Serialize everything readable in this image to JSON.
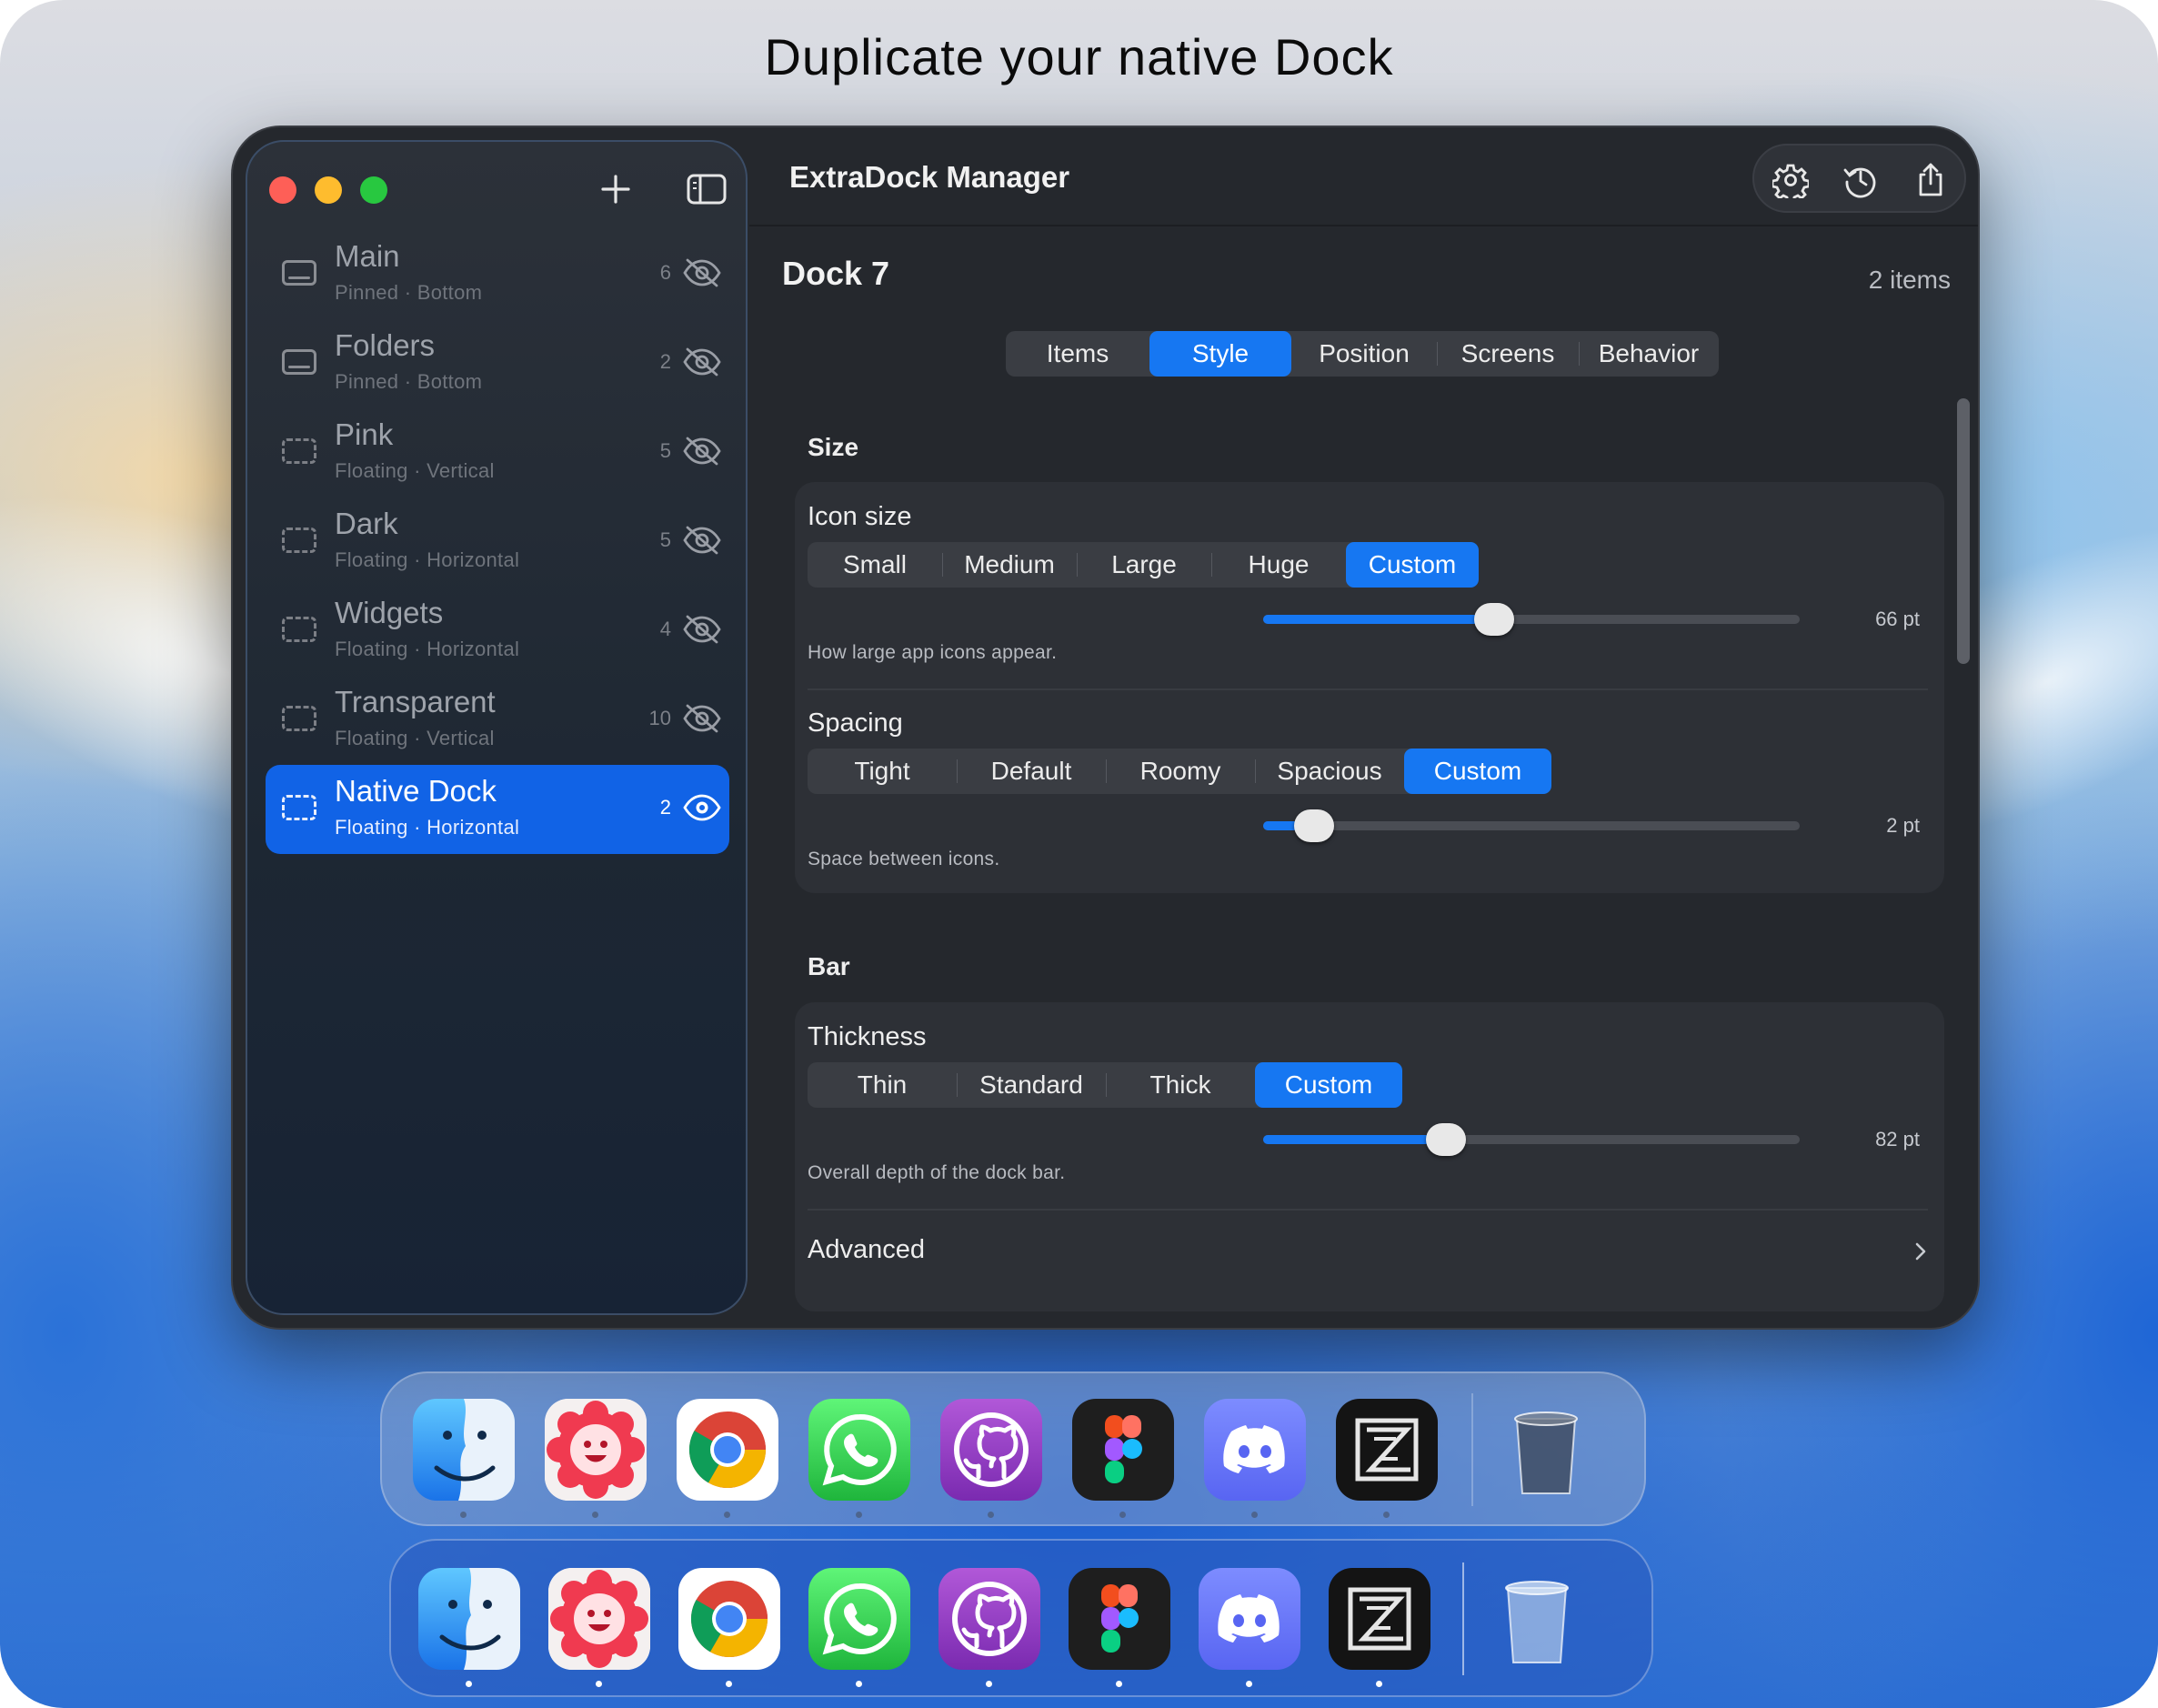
{
  "headline": "Duplicate your native Dock",
  "window": {
    "title": "ExtraDock Manager",
    "toolbar_icons": [
      "plus-icon",
      "sidebar-toggle-icon",
      "gear-icon",
      "history-icon",
      "share-icon"
    ]
  },
  "sidebar": {
    "items": [
      {
        "name": "Main",
        "subtitle": "Pinned · Bottom",
        "count": "6",
        "kind": "pinned",
        "visible": false,
        "selected": false
      },
      {
        "name": "Folders",
        "subtitle": "Pinned · Bottom",
        "count": "2",
        "kind": "pinned",
        "visible": false,
        "selected": false
      },
      {
        "name": "Pink",
        "subtitle": "Floating · Vertical",
        "count": "5",
        "kind": "floating",
        "visible": false,
        "selected": false
      },
      {
        "name": "Dark",
        "subtitle": "Floating · Horizontal",
        "count": "5",
        "kind": "floating",
        "visible": false,
        "selected": false
      },
      {
        "name": "Widgets",
        "subtitle": "Floating · Horizontal",
        "count": "4",
        "kind": "floating",
        "visible": false,
        "selected": false
      },
      {
        "name": "Transparent",
        "subtitle": "Floating · Vertical",
        "count": "10",
        "kind": "floating",
        "visible": false,
        "selected": false
      },
      {
        "name": "Native Dock",
        "subtitle": "Floating · Horizontal",
        "count": "2",
        "kind": "floating",
        "visible": true,
        "selected": true
      }
    ]
  },
  "detail": {
    "dock_title": "Dock 7",
    "items_count": "2 items",
    "tabs": [
      "Items",
      "Style",
      "Position",
      "Screens",
      "Behavior"
    ],
    "active_tab": "Style",
    "size_section": "Size",
    "icon_size": {
      "label": "Icon size",
      "options": [
        "Small",
        "Medium",
        "Large",
        "Huge",
        "Custom"
      ],
      "selected": "Custom",
      "value_text": "66 pt",
      "fraction": 0.43,
      "hint": "How large app icons appear."
    },
    "spacing": {
      "label": "Spacing",
      "options": [
        "Tight",
        "Default",
        "Roomy",
        "Spacious",
        "Custom"
      ],
      "selected": "Custom",
      "value_text": "2 pt",
      "fraction": 0.095,
      "hint": "Space between icons."
    },
    "bar_section": "Bar",
    "thickness": {
      "label": "Thickness",
      "options": [
        "Thin",
        "Standard",
        "Thick",
        "Custom"
      ],
      "selected": "Custom",
      "value_text": "82 pt",
      "fraction": 0.34,
      "hint": "Overall depth of the dock bar."
    },
    "advanced_label": "Advanced"
  },
  "docks": {
    "apps": [
      "finder-icon",
      "flower-app-icon",
      "chrome-icon",
      "whatsapp-icon",
      "github-icon",
      "figma-icon",
      "discord-icon",
      "zed-icon",
      "trash-icon"
    ]
  },
  "colors": {
    "accent": "#1677f2",
    "selection": "#1163e6",
    "window_bg": "#25282d",
    "card_bg": "#2d3036"
  }
}
